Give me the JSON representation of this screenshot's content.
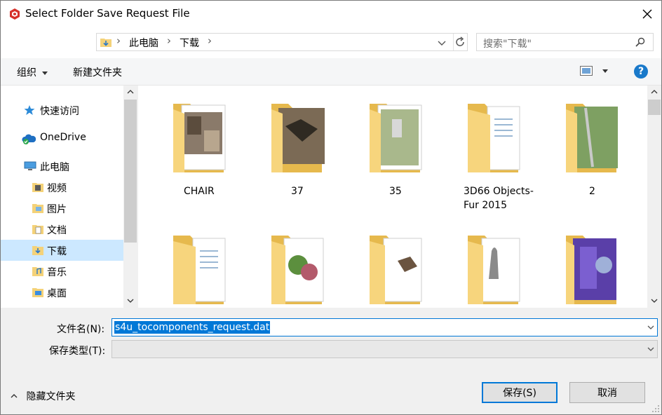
{
  "window": {
    "title": "Select Folder Save Request File"
  },
  "nav": {
    "breadcrumb": [
      "此电脑",
      "下载"
    ],
    "search_placeholder": "搜索\"下载\""
  },
  "toolbar": {
    "organize": "组织",
    "new_folder": "新建文件夹",
    "help": "?"
  },
  "sidebar": {
    "items": [
      {
        "label": "快速访问",
        "icon": "star-icon"
      },
      {
        "label": "OneDrive",
        "icon": "cloud-icon"
      },
      {
        "label": "此电脑",
        "icon": "computer-icon"
      },
      {
        "label": "视频",
        "icon": "video-folder-icon"
      },
      {
        "label": "图片",
        "icon": "pictures-folder-icon"
      },
      {
        "label": "文档",
        "icon": "documents-folder-icon"
      },
      {
        "label": "下载",
        "icon": "downloads-folder-icon",
        "selected": true
      },
      {
        "label": "音乐",
        "icon": "music-folder-icon"
      },
      {
        "label": "桌面",
        "icon": "desktop-folder-icon"
      }
    ]
  },
  "files": {
    "row1": [
      "CHAIR",
      "37",
      "35",
      "3D66 Objects-Fur 2015",
      "2"
    ]
  },
  "form": {
    "filename_label": "文件名(N):",
    "filename_value": "s4u_tocomponents_request.dat",
    "filetype_label": "保存类型(T):",
    "filetype_value": ""
  },
  "footer": {
    "hide_folders": "隐藏文件夹",
    "save": "保存(S)",
    "cancel": "取消"
  },
  "colors": {
    "accent": "#0078d7",
    "selected_nav": "#cce8ff",
    "folder": "#f4d279"
  }
}
